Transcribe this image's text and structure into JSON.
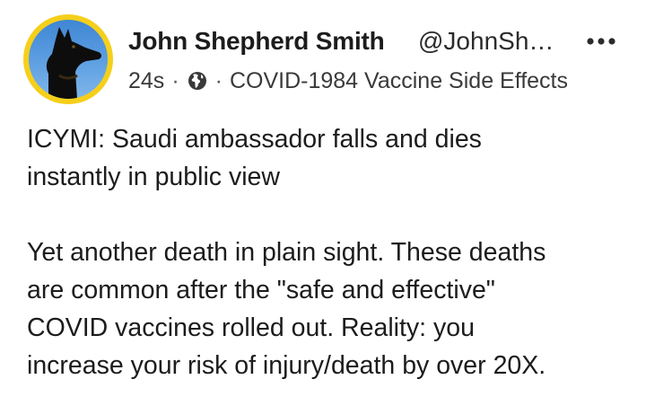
{
  "post": {
    "author": {
      "name": "John Shepherd Smith",
      "handle": "@JohnSh…",
      "avatar_icon": "black-dog-avatar-icon",
      "avatar_ring_color": "#f5cf1b"
    },
    "meta": {
      "time": "24s",
      "separator": "·",
      "privacy_icon": "globe-icon",
      "group": "COVID-1984 Vaccine Side Effects"
    },
    "menu_icon": "more-options-icon",
    "paragraphs": [
      "ICYMI: Saudi ambassador falls and dies\ninstantly in public view",
      "Yet another death in plain sight. These deaths\nare common after the \"safe and effective\"\nCOVID vaccines rolled out. Reality: you\nincrease your risk of injury/death by over 20X."
    ]
  }
}
